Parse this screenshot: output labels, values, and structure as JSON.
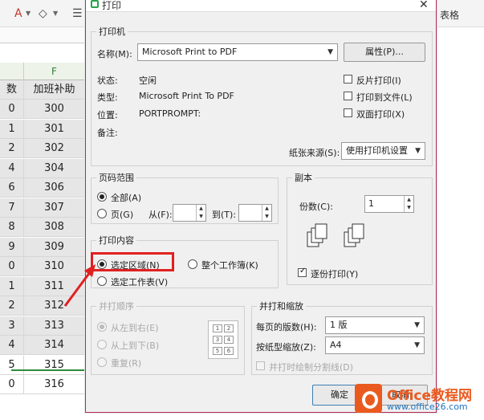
{
  "spreadsheet": {
    "toolbar_right": "表格",
    "column_header": "F",
    "column_title": "加班补助",
    "left_header": "数",
    "values": [
      "300",
      "301",
      "302",
      "304",
      "306",
      "307",
      "308",
      "309",
      "310",
      "311",
      "312",
      "313",
      "314",
      "315",
      "316"
    ],
    "left_digits": [
      "0",
      "1",
      "2",
      "4",
      "6",
      "7",
      "8",
      "9",
      "0",
      "1",
      "2",
      "3",
      "4",
      "5",
      "0"
    ]
  },
  "dialog": {
    "title": "打印",
    "printer_group": "打印机",
    "name_label": "名称(M):",
    "printer_name": "Microsoft Print to PDF",
    "properties_button": "属性(P)...",
    "status_label": "状态:",
    "status_value": "空闲",
    "type_label": "类型:",
    "type_value": "Microsoft Print To PDF",
    "location_label": "位置:",
    "location_value": "PORTPROMPT:",
    "comment_label": "备注:",
    "reverse_print": "反片打印(I)",
    "print_to_file": "打印到文件(L)",
    "duplex_print": "双面打印(X)",
    "paper_source_label": "纸张来源(S):",
    "paper_source_value": "使用打印机设置",
    "page_range_group": "页码范围",
    "all_label": "全部(A)",
    "pages_label": "页(G)",
    "from_label": "从(F):",
    "to_label": "到(T):",
    "copies_group": "副本",
    "copies_label": "份数(C):",
    "copies_value": "1",
    "collate_label": "逐份打印(Y)",
    "print_content_group": "打印内容",
    "selection_label": "选定区域(N)",
    "whole_workbook_label": "整个工作簿(K)",
    "selected_sheet_label": "选定工作表(V)",
    "print_order_group": "并打顺序",
    "left_to_right": "从左到右(E)",
    "top_to_bottom": "从上到下(B)",
    "repeat": "重复(R)",
    "order_pic": [
      "1",
      "2",
      "3",
      "4",
      "5",
      "6"
    ],
    "scale_group": "并打和缩放",
    "pages_per_sheet_label": "每页的版数(H):",
    "pages_per_sheet_value": "1 版",
    "scale_paper_label": "按纸型缩放(Z):",
    "scale_paper_value": "A4",
    "draw_divider_label": "并打时绘制分割线(D)",
    "ok_button": "确定",
    "cancel_button": "取消"
  },
  "watermark": {
    "title": "Office教程网",
    "url": "www.office26.com"
  },
  "colors": {
    "highlight_red": "#e02020",
    "brand_orange": "#ea5a1f",
    "header_green": "#2e8b3e"
  }
}
